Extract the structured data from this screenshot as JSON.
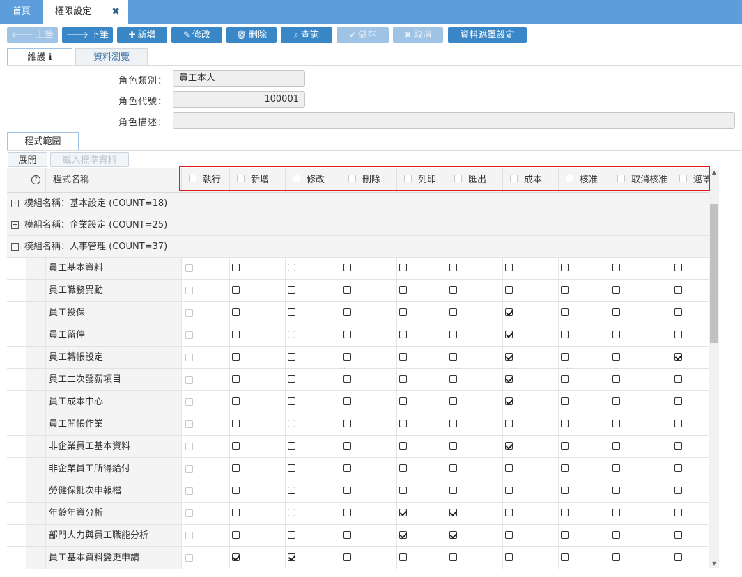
{
  "tabs": {
    "home": "首頁",
    "permission": "權限設定",
    "close_icon": "✖"
  },
  "toolbar": {
    "prev": "上筆",
    "next": "下筆",
    "add": "新增",
    "edit": "修改",
    "delete": "刪除",
    "query": "查詢",
    "save": "儲存",
    "cancel": "取消",
    "mask": "資料遮罩設定"
  },
  "subtabs": {
    "maintain": "維護",
    "info_icon": "ℹ",
    "browse": "資料瀏覽"
  },
  "form": {
    "role_type_label": "角色類別：",
    "role_type": "員工本人",
    "role_code_label": "角色代號：",
    "role_code": "100001",
    "role_desc_label": "角色描述：",
    "role_desc": ""
  },
  "section": {
    "scope_tab": "程式範圍",
    "expand": "展開",
    "load_std": "載入標準資料"
  },
  "grid": {
    "help_icon": "?",
    "name_header": "程式名稱",
    "columns": [
      "執行",
      "新增",
      "修改",
      "刪除",
      "列印",
      "匯出",
      "成本",
      "核准",
      "取消核准",
      "遮罩"
    ],
    "groups": [
      {
        "label": "模組名稱：基本設定 (COUNT=18)",
        "expanded": false
      },
      {
        "label": "模組名稱：企業設定 (COUNT=25)",
        "expanded": false
      },
      {
        "label": "模組名稱：人事管理 (COUNT=37)",
        "expanded": true
      }
    ],
    "rows": [
      {
        "name": "員工基本資料",
        "checks": [
          0,
          0,
          0,
          0,
          0,
          0,
          0,
          0,
          0,
          0
        ]
      },
      {
        "name": "員工職務異動",
        "checks": [
          0,
          0,
          0,
          0,
          0,
          0,
          0,
          0,
          0,
          0
        ]
      },
      {
        "name": "員工投保",
        "checks": [
          0,
          0,
          0,
          0,
          0,
          0,
          1,
          0,
          0,
          0
        ]
      },
      {
        "name": "員工留停",
        "checks": [
          0,
          0,
          0,
          0,
          0,
          0,
          1,
          0,
          0,
          0
        ]
      },
      {
        "name": "員工轉帳設定",
        "checks": [
          0,
          0,
          0,
          0,
          0,
          0,
          1,
          0,
          0,
          1
        ]
      },
      {
        "name": "員工二次發薪項目",
        "checks": [
          0,
          0,
          0,
          0,
          0,
          0,
          1,
          0,
          0,
          0
        ]
      },
      {
        "name": "員工成本中心",
        "checks": [
          0,
          0,
          0,
          0,
          0,
          0,
          1,
          0,
          0,
          0
        ]
      },
      {
        "name": "員工開帳作業",
        "checks": [
          0,
          0,
          0,
          0,
          0,
          0,
          0,
          0,
          0,
          0
        ]
      },
      {
        "name": "非企業員工基本資料",
        "checks": [
          0,
          0,
          0,
          0,
          0,
          0,
          1,
          0,
          0,
          0
        ]
      },
      {
        "name": "非企業員工所得給付",
        "checks": [
          0,
          0,
          0,
          0,
          0,
          0,
          0,
          0,
          0,
          0
        ]
      },
      {
        "name": "勞健保批次申報檔",
        "checks": [
          0,
          0,
          0,
          0,
          0,
          0,
          0,
          0,
          0,
          0
        ]
      },
      {
        "name": "年齡年資分析",
        "checks": [
          0,
          0,
          0,
          0,
          1,
          1,
          0,
          0,
          0,
          0
        ]
      },
      {
        "name": "部門人力與員工職能分析",
        "checks": [
          0,
          0,
          0,
          0,
          1,
          1,
          0,
          0,
          0,
          0
        ]
      },
      {
        "name": "員工基本資料變更申請",
        "checks": [
          0,
          1,
          1,
          0,
          0,
          0,
          0,
          0,
          0,
          0
        ]
      }
    ]
  }
}
